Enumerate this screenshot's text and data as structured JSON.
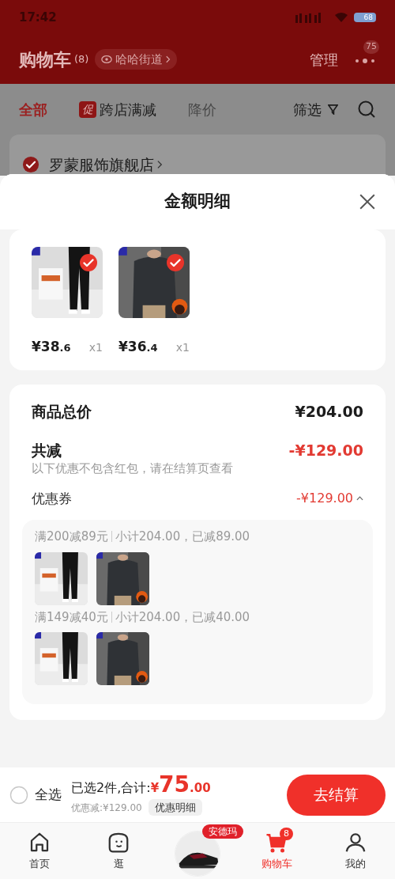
{
  "status_bar": {
    "time": "17:42",
    "battery": "68"
  },
  "header": {
    "title": "购物车",
    "count": "(8)",
    "location": "哈哈街道",
    "manage": "管理",
    "more_badge": "75"
  },
  "tabs": [
    {
      "label": "全部",
      "selected": true,
      "dimmed": false
    },
    {
      "label": "跨店满减",
      "badge": "促",
      "selected": false,
      "dimmed": false
    },
    {
      "label": "降价",
      "selected": false,
      "dimmed": true
    }
  ],
  "filter": "筛选",
  "store": {
    "name": "罗蒙服饰旗舰店",
    "checked": true
  },
  "sheet": {
    "title": "金额明细",
    "items": [
      {
        "kind": "pants",
        "price": "¥38",
        "price_decimal": ".6",
        "qty": "x1",
        "checked": true
      },
      {
        "kind": "sweater",
        "price": "¥36",
        "price_decimal": ".4",
        "qty": "x1",
        "checked": true
      }
    ],
    "total_label": "商品总价",
    "total": "¥204.00",
    "discount_label": "共减",
    "discount": "-¥129.00",
    "discount_note": "以下优惠不包含红包，请在结算页查看",
    "coupon_label": "优惠券",
    "coupon": "-¥129.00",
    "coupon_expanded": true,
    "coupons": [
      {
        "rule": "满200减89元",
        "detail": "小计204.00，已减89.00",
        "items": [
          {
            "kind": "pants"
          },
          {
            "kind": "sweater"
          }
        ]
      },
      {
        "rule": "满149减40元",
        "detail": "小计204.00，已减40.00",
        "items": [
          {
            "kind": "pants"
          },
          {
            "kind": "sweater"
          }
        ]
      }
    ]
  },
  "bottom_bar": {
    "select_all": {
      "label": "全选",
      "checked": false
    },
    "selected_text": "已选2件,合计:",
    "total_currency": "¥",
    "total_int": "75",
    "total_decimal": ".00",
    "saved": "优惠减:¥129.00",
    "detail_button": "优惠明细",
    "checkout": "去结算"
  },
  "nav": [
    {
      "kind": "home",
      "label": "首页",
      "selected": false
    },
    {
      "kind": "browse",
      "label": "逛",
      "selected": false
    },
    {
      "kind": "promo",
      "badge": "安德玛"
    },
    {
      "kind": "cart",
      "label": "购物车",
      "badge": "8",
      "selected": true
    },
    {
      "kind": "me",
      "label": "我的",
      "selected": false
    }
  ]
}
